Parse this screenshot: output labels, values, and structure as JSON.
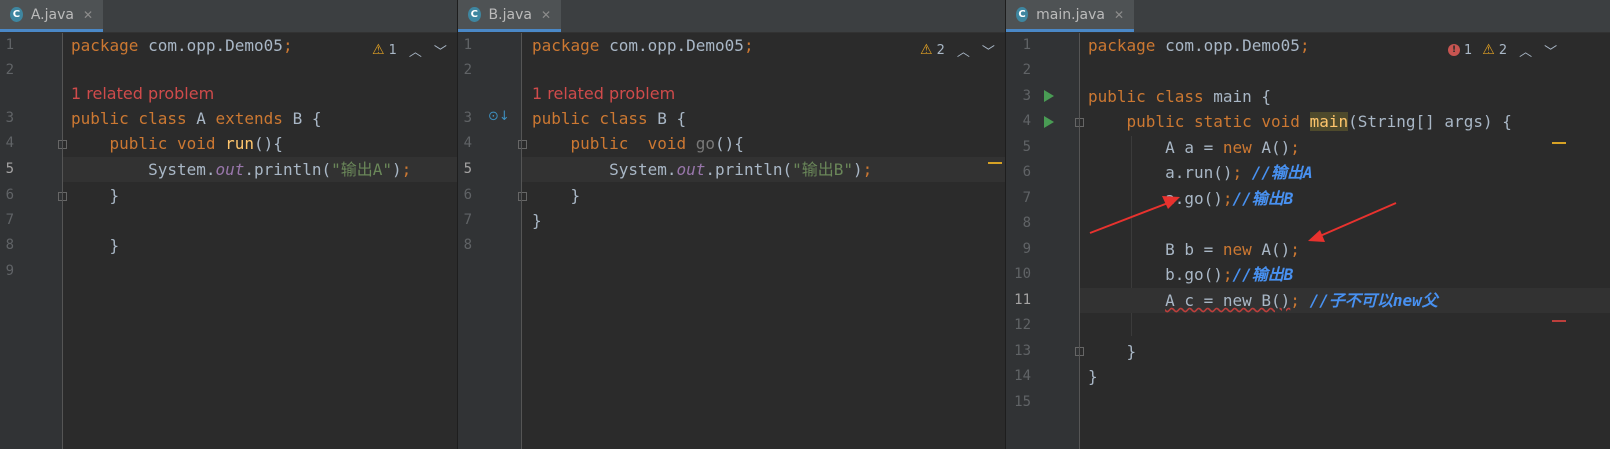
{
  "panes": {
    "a": {
      "tab": {
        "icon": "c-class-icon",
        "icon_letter": "C",
        "title": "A.java",
        "close": "✕"
      },
      "indicators": {
        "warn_count": "1"
      },
      "line_numbers": [
        "1",
        "2",
        "3",
        "4",
        "5",
        "6",
        "7",
        "8",
        "9"
      ],
      "hint": "1 related problem",
      "code": {
        "l1": {
          "kw": "package",
          "rest": " com.opp.Demo05",
          "semi": ";"
        },
        "l3": {
          "kw1": "public class",
          "name": " A ",
          "kw2": "extends",
          "rest": " B {"
        },
        "l4": {
          "kw": "    public void",
          "fn": " run",
          "rest": "(){"
        },
        "l5": {
          "a": "        System.",
          "field": "out",
          "b": ".println(",
          "str": "\"输出A\"",
          "c": ")",
          "semi": ";"
        },
        "l6": "    }",
        "l8": "    }"
      }
    },
    "b": {
      "tab": {
        "icon": "c-class-icon",
        "icon_letter": "C",
        "title": "B.java",
        "close": "✕"
      },
      "indicators": {
        "warn_count": "2"
      },
      "line_numbers": [
        "1",
        "2",
        "3",
        "4",
        "5",
        "6",
        "7",
        "8"
      ],
      "hint": "1 related problem",
      "code": {
        "l1": {
          "kw": "package",
          "rest": " com.opp.Demo05",
          "semi": ";"
        },
        "l3": {
          "kw": "public class",
          "rest": " B {"
        },
        "l4": {
          "kw": "    public  void",
          "fn": " go",
          "rest": "(){"
        },
        "l5": {
          "a": "        System.",
          "field": "out",
          "b": ".println(",
          "str": "\"输出B\"",
          "c": ")",
          "semi": ";"
        },
        "l6": "    }",
        "l7": "}"
      }
    },
    "main": {
      "tab": {
        "icon": "c-class-icon",
        "icon_letter": "C",
        "title": "main.java",
        "close": "✕"
      },
      "indicators": {
        "err_count": "1",
        "warn_count": "2"
      },
      "line_numbers": [
        "1",
        "2",
        "3",
        "4",
        "5",
        "6",
        "7",
        "8",
        "9",
        "10",
        "11",
        "12",
        "13",
        "14",
        "15"
      ],
      "code": {
        "l1": {
          "kw": "package",
          "rest": " com.opp.Demo05",
          "semi": ";"
        },
        "l3": {
          "kw": "public class",
          "rest": " main {"
        },
        "l4": {
          "kw": "    public static void",
          "sp": " ",
          "fn": "main",
          "rest": "(String[] args) {"
        },
        "l5": {
          "a": "        A a = ",
          "kw": "new",
          "b": " A()",
          "semi": ";"
        },
        "l6": {
          "a": "        a.run()",
          "semi": ";",
          "cmt": " //输出A"
        },
        "l7": {
          "a": "        a.go()",
          "semi": ";",
          "cmt": "//输出B"
        },
        "l9": {
          "a": "        B b = ",
          "kw": "new",
          "b": " A()",
          "semi": ";"
        },
        "l10": {
          "a": "        b.go()",
          "semi": ";",
          "cmt": "//输出B"
        },
        "l11": {
          "a": "        ",
          "err": "A c = new B()",
          "semi": ";",
          "cmt": " //子不可以new父"
        },
        "l13": "    }",
        "l14": "}"
      }
    }
  },
  "colors": {
    "keyword": "#cc7832",
    "string": "#6a8759",
    "comment": "#4891f1",
    "error": "#d04b4b",
    "annotation_arrow": "#e8322e"
  }
}
